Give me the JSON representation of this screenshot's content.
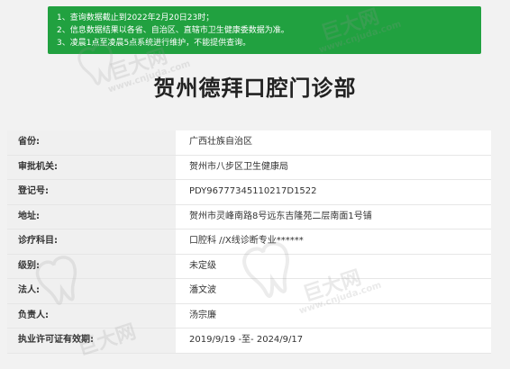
{
  "notice": {
    "lines": [
      "1、查询数据截止到2022年2月20日23时；",
      "2、信息数据结果以各省、自治区、直辖市卫生健康委数据为准。",
      "3、凌晨1点至凌晨5点系统进行维护，不能提供查询。"
    ]
  },
  "title": "贺州德拜口腔门诊部",
  "rows": [
    {
      "label": "省份:",
      "value": "广西壮族自治区"
    },
    {
      "label": "审批机关:",
      "value": "贺州市八步区卫生健康局"
    },
    {
      "label": "登记号:",
      "value": "PDY96777345110217D1522"
    },
    {
      "label": "地址:",
      "value": "贺州市灵峰南路8号远东吉隆苑二层南面1号铺"
    },
    {
      "label": "诊疗科目:",
      "value": "口腔科 //X线诊断专业******"
    },
    {
      "label": "级别:",
      "value": "未定级"
    },
    {
      "label": "法人:",
      "value": "潘文波"
    },
    {
      "label": "负责人:",
      "value": "汤宗廉"
    },
    {
      "label": "执业许可证有效期:",
      "value": "2019/9/19 -至- 2024/9/17"
    }
  ],
  "watermark": {
    "brand": "巨大网",
    "site": "www.cnjuda.com"
  },
  "colors": {
    "notice_bg": "#21a140",
    "label_bg": "#f0f0f0",
    "value_bg": "#ffffff"
  }
}
